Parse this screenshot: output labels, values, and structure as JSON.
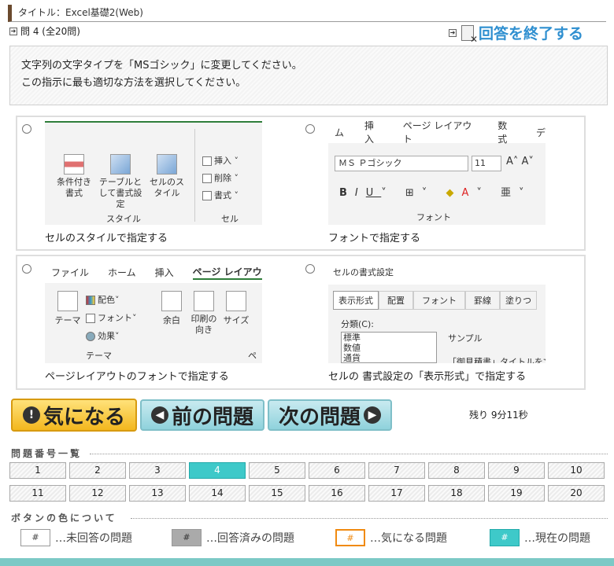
{
  "header": {
    "title": "タイトル：Excel基礎2(Web)",
    "question_label": "問 4 (全20問)",
    "finish_label": "回答を終了する"
  },
  "prompt": {
    "line1": "文字列の文字タイプを「MSゴシック」に変更してください。",
    "line2": "この指示に最も適切な方法を選択してください。"
  },
  "options": [
    {
      "caption": "セルのスタイルで指定する",
      "shot": {
        "items": [
          "条件付き書式",
          "テーブルとして書式設定",
          "セルのスタイル"
        ],
        "side": [
          "挿入",
          "削除",
          "書式"
        ],
        "group1": "スタイル",
        "group2": "セル"
      }
    },
    {
      "caption": "フォントで指定する",
      "shot": {
        "tabs": [
          "ム",
          "挿入",
          "ページ レイアウト",
          "数式",
          "デ"
        ],
        "font": "ＭＳ Ｐゴシック",
        "size": "11",
        "group": "フォント"
      }
    },
    {
      "caption": "ページレイアウトのフォントで指定する",
      "shot": {
        "tabs": [
          "ファイル",
          "ホーム",
          "挿入",
          "ページ レイアウ"
        ],
        "theme": "テーマ",
        "colors": "配色",
        "fonts": "フォント",
        "effects": "効果",
        "margin": "余白",
        "orient": "印刷の向き",
        "size": "サイズ",
        "group": "テーマ",
        "group2": "ペ"
      }
    },
    {
      "caption": "セルの 書式設定の「表示形式」で指定する",
      "shot": {
        "title": "セルの書式設定",
        "tabs": [
          "表示形式",
          "配置",
          "フォント",
          "罫線",
          "塗りつ"
        ],
        "category": "分類(C):",
        "list": [
          "標準",
          "数値",
          "通貨"
        ],
        "sample": "サンプル",
        "sample_val": "「御見積書」タイトルを文字"
      }
    }
  ],
  "buttons": {
    "flag": "気になる",
    "prev": "前の問題",
    "next": "次の問題"
  },
  "remaining": "残り 9分11秒",
  "numbers_heading": "問題番号一覧",
  "numbers": [
    "1",
    "2",
    "3",
    "4",
    "5",
    "6",
    "7",
    "8",
    "9",
    "10",
    "11",
    "12",
    "13",
    "14",
    "15",
    "16",
    "17",
    "18",
    "19",
    "20"
  ],
  "current_number": 4,
  "legend_heading": "ボタンの色について",
  "legend": [
    {
      "mark": "#",
      "text": "…未回答の問題",
      "color": "#ffffff"
    },
    {
      "mark": "#",
      "text": "…回答済みの問題",
      "color": "#aaaaaa"
    },
    {
      "mark": "#",
      "text": "…気になる問題",
      "color": "#ffffff"
    },
    {
      "mark": "#",
      "text": "…現在の問題",
      "color": "#3ec9c9"
    }
  ]
}
